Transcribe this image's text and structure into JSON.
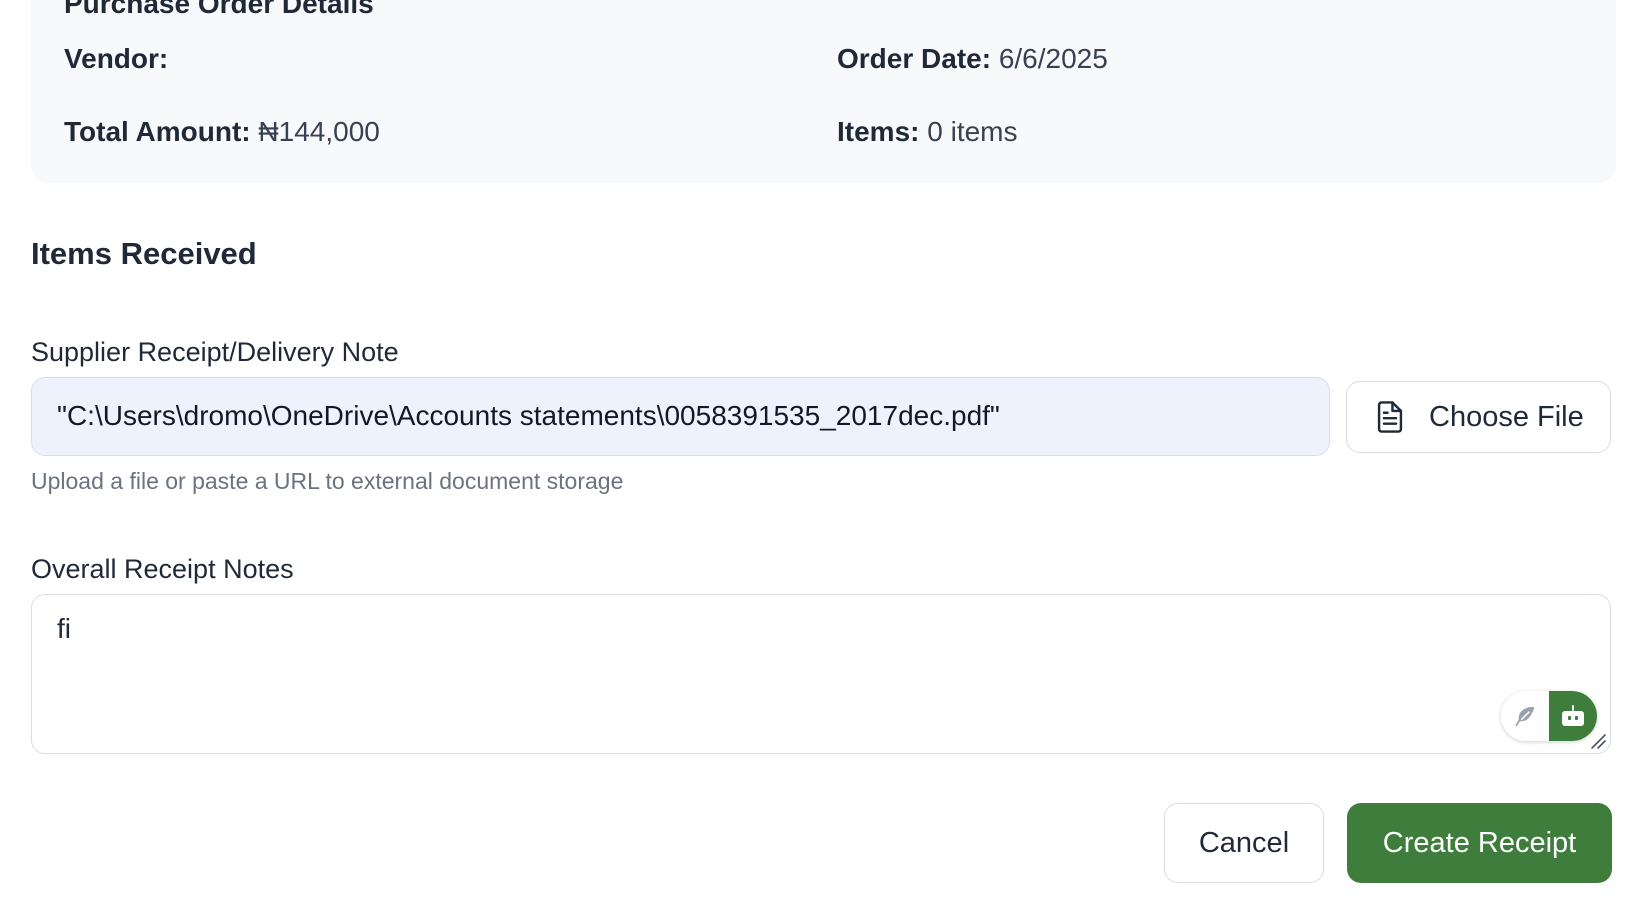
{
  "purchase_order": {
    "title": "Purchase Order Details",
    "vendor_label": "Vendor:",
    "vendor_value": "",
    "order_date_label": "Order Date:",
    "order_date_value": "6/6/2025",
    "total_amount_label": "Total Amount:",
    "total_amount_value": "₦144,000",
    "items_label": "Items:",
    "items_value": "0 items"
  },
  "items_received": {
    "title": "Items Received"
  },
  "supplier_receipt": {
    "label": "Supplier Receipt/Delivery Note",
    "value": "\"C:\\Users\\dromo\\OneDrive\\Accounts statements\\0058391535_2017dec.pdf\"",
    "choose_file_label": "Choose File",
    "hint": "Upload a file or paste a URL to external document storage"
  },
  "receipt_notes": {
    "label": "Overall Receipt Notes",
    "value": "fi"
  },
  "actions": {
    "cancel_label": "Cancel",
    "create_label": "Create Receipt"
  },
  "icons": {
    "file": "file-text-icon",
    "feather": "feather-icon",
    "bot": "bot-icon",
    "resize": "resize-handle-icon"
  },
  "colors": {
    "primary": "#3e7d3b",
    "card_bg": "#f8f9fb",
    "input_bg": "#eef2fd",
    "muted_text": "#6b7280"
  }
}
